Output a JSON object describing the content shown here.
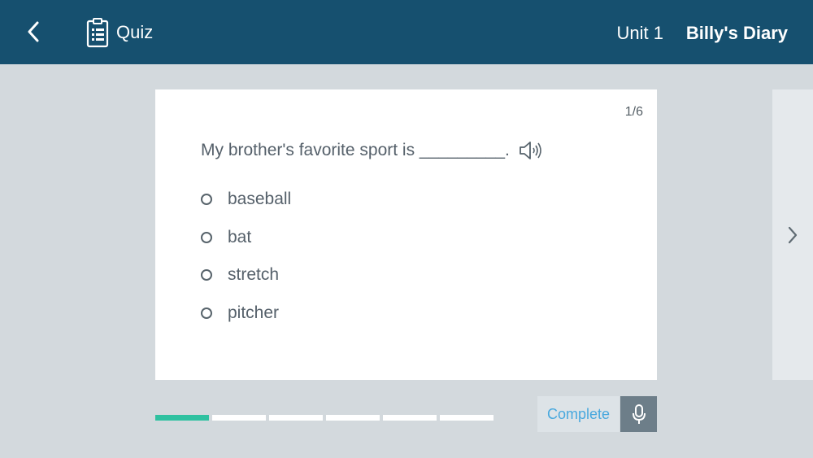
{
  "header": {
    "quiz_label": "Quiz",
    "unit_label": "Unit 1",
    "title": "Billy's Diary",
    "back_icon": "chevron-left-icon",
    "quiz_icon": "clipboard-list-icon"
  },
  "card": {
    "counter": "1/6",
    "question": "My brother's favorite sport is _________.",
    "speaker_icon": "speaker-icon",
    "options": [
      {
        "label": "baseball"
      },
      {
        "label": "bat"
      },
      {
        "label": "stretch"
      },
      {
        "label": "pitcher"
      }
    ]
  },
  "progress": {
    "total": 6,
    "current": 1
  },
  "footer": {
    "complete_label": "Complete",
    "mic_icon": "microphone-icon"
  },
  "colors": {
    "header_bg": "#16506f",
    "page_bg": "#d3d9dd",
    "progress_active": "#2fc1a0",
    "complete_text": "#48a8de",
    "mic_bg": "#6d7e89"
  }
}
